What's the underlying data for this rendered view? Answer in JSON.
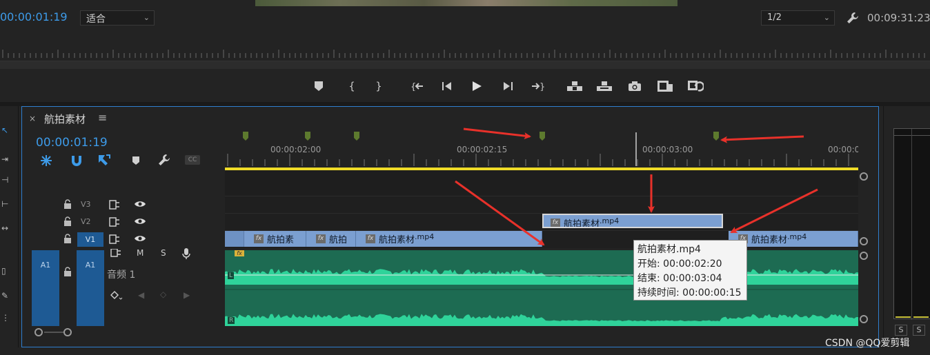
{
  "program_monitor": {
    "current_timecode": "00:00:01:19",
    "zoom_select": "适合",
    "resolution_select": "1/2",
    "duration_timecode": "00:09:31:23"
  },
  "transport_icons": [
    "add-marker-icon",
    "mark-in-icon",
    "mark-out-icon",
    "go-to-in-icon",
    "step-back-icon",
    "play-icon",
    "step-forward-icon",
    "go-to-out-icon",
    "lift-icon",
    "extract-icon",
    "export-frame-icon",
    "insert-icon",
    "overwrite-icon"
  ],
  "timeline": {
    "sequence_name": "航拍素材",
    "close_glyph": "×",
    "menu_glyph": "≡",
    "timecode": "00:00:01:19",
    "cc_label": "CC",
    "ruler_labels": [
      "00:00:02:00",
      "00:00:02:15",
      "00:00:03:00",
      "00:00:0"
    ],
    "tracks": {
      "v3": "V3",
      "v2": "V2",
      "v1": "V1",
      "a1_source": "A1",
      "a1": "A1",
      "audio_name": "音频 1",
      "mute": "M",
      "solo": "S"
    },
    "video_clips": [
      {
        "name": "航拍素",
        "ext": ""
      },
      {
        "name": "航拍",
        "ext": ""
      },
      {
        "name": "航拍素材",
        "ext": ".mp4"
      },
      {
        "name": "航拍素材",
        "ext": ".mp4"
      }
    ],
    "dragged_clip": {
      "name": "航拍素材",
      "ext": ".mp4"
    },
    "fx_badge": "fx",
    "audio_channel_labels": [
      "L",
      "R"
    ]
  },
  "tooltip": {
    "title": "航拍素材.mp4",
    "start": "开始: 00:00:02:20",
    "end": "结束: 00:00:03:04",
    "duration": "持续时间: 00:00:00:15"
  },
  "meters": {
    "solo_left": "S",
    "solo_right": "S"
  },
  "watermark": "CSDN @QQ爱剪辑",
  "colors": {
    "accent_blue": "#3d9be9",
    "video_clip": "#7b9fd1",
    "audio_clip": "#1d6b52",
    "waveform": "#2fd39a",
    "work_area": "#f0dc28",
    "marker": "#5d7a2e",
    "annotation_arrow": "#e8312a"
  }
}
